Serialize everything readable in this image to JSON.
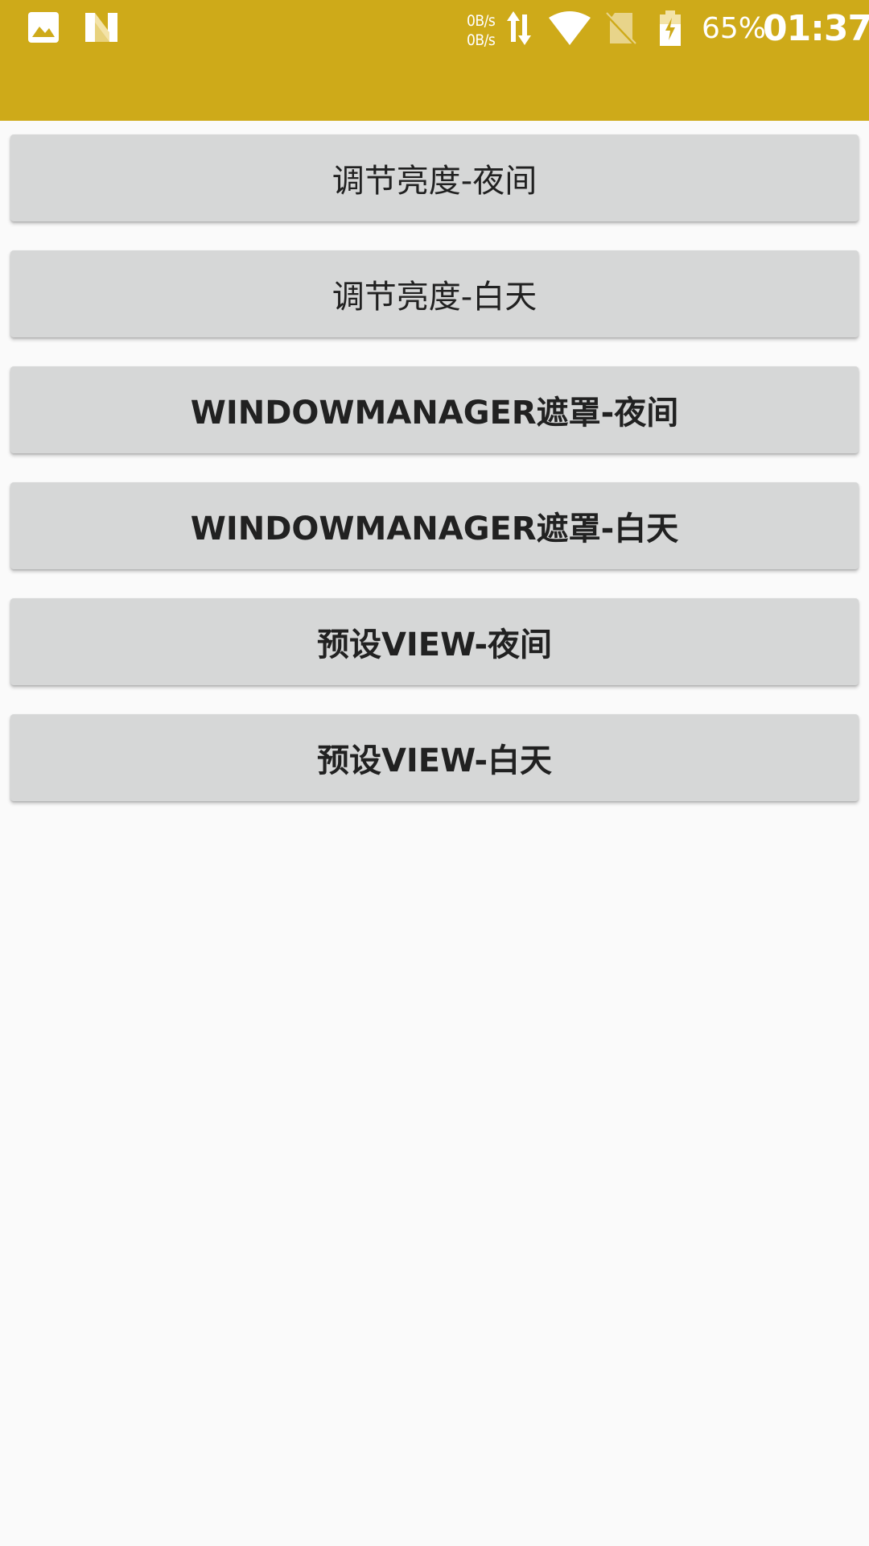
{
  "status_bar": {
    "net_up": "0B/s",
    "net_down": "0B/s",
    "battery_percent": "65%",
    "time": "01:37",
    "icons": [
      "gallery-icon",
      "n-logo-icon",
      "data-arrows-icon",
      "wifi-icon",
      "no-sim-icon",
      "battery-charging-icon"
    ]
  },
  "colors": {
    "appbar": "#ceaa19",
    "background": "#fafafa",
    "button": "#d6d7d7",
    "button_text": "#212121"
  },
  "buttons": [
    {
      "label": "调节亮度-夜间"
    },
    {
      "label": "调节亮度-白天"
    },
    {
      "label": "WINDOWMANAGER遮罩-夜间"
    },
    {
      "label": "WINDOWMANAGER遮罩-白天"
    },
    {
      "label": "预设VIEW-夜间"
    },
    {
      "label": "预设VIEW-白天"
    }
  ]
}
